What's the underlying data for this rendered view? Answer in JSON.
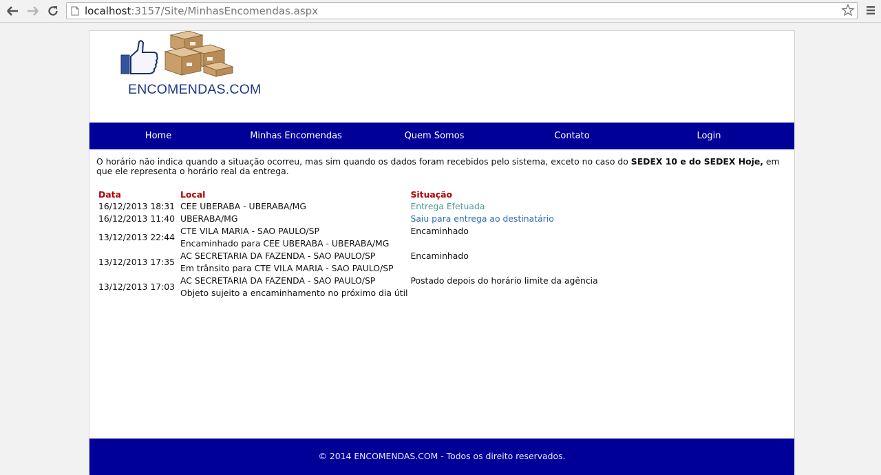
{
  "browser": {
    "url_host": "localhost",
    "url_path": ":3157/Site/MinhasEncomendas.aspx"
  },
  "brand": {
    "logo_text": "ENCOMENDAS.COM"
  },
  "nav": {
    "items": [
      {
        "label": "Home"
      },
      {
        "label": "Minhas Encomendas"
      },
      {
        "label": "Quem Somos"
      },
      {
        "label": "Contato"
      },
      {
        "label": "Login"
      }
    ]
  },
  "notice": {
    "text_start": "O horário não indica quando a situação ocorreu, mas sim quando os dados foram recebidos pelo sistema, exceto no caso do ",
    "text_bold": "SEDEX 10 e do SEDEX Hoje,",
    "text_end": " em que ele representa o horário real da entrega."
  },
  "tracking": {
    "headers": {
      "date": "Data",
      "location": "Local",
      "status": "Situação"
    },
    "rows": [
      {
        "date": "16/12/2013 18:31",
        "location": "CEE UBERABA - UBERABA/MG",
        "status": "Entrega Efetuada",
        "detail": ""
      },
      {
        "date": "16/12/2013 11:40",
        "location": "UBERABA/MG",
        "status": "Saiu para entrega ao destinatário",
        "detail": ""
      },
      {
        "date": "13/12/2013 22:44",
        "location": "CTE VILA MARIA - SAO PAULO/SP",
        "status": "Encaminhado",
        "detail": "Encaminhado para CEE UBERABA - UBERABA/MG"
      },
      {
        "date": "13/12/2013 17:35",
        "location": "AC SECRETARIA DA FAZENDA - SAO PAULO/SP",
        "status": "Encaminhado",
        "detail": "Em trânsito para CTE VILA MARIA - SAO PAULO/SP"
      },
      {
        "date": "13/12/2013 17:03",
        "location": "AC SECRETARIA DA FAZENDA - SAO PAULO/SP",
        "status": "Postado depois do horário limite da agência",
        "detail": "Objeto sujeito a encaminhamento no próximo dia útil"
      }
    ]
  },
  "footer": {
    "text": "© 2014 ENCOMENDAS.COM - Todos os direito reservados."
  },
  "colors": {
    "nav_bg": "#000099",
    "header_red": "#b30000",
    "status_delivered": "#4f9a94",
    "status_out": "#2b6fb8"
  }
}
